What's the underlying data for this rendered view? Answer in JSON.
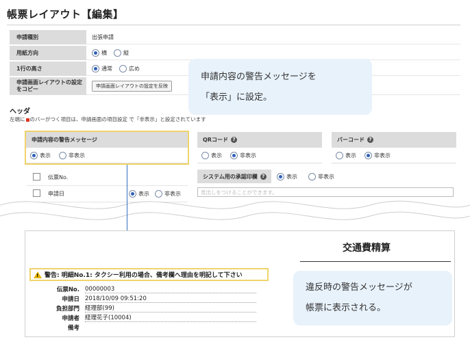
{
  "page_title": "帳票レイアウト【編集】",
  "form": {
    "rows": [
      {
        "label": "申請種別",
        "value": "出張申請"
      },
      {
        "label": "用紙方向",
        "options": [
          "横",
          "縦"
        ],
        "selected": 0
      },
      {
        "label": "1行の高さ",
        "options": [
          "通常",
          "広め"
        ],
        "selected": 0
      },
      {
        "label": "申請画面レイアウトの設定をコピー",
        "button": "申請画面レイアウトの設定を反映"
      }
    ]
  },
  "callout_top": {
    "line1": "申請内容の警告メッセージを",
    "line2": "「表示」に設定。"
  },
  "header_section": {
    "title": "ヘッダ",
    "note_before": "左端に",
    "note_after": "のバーがつく項目は、申請画面の項目設定 で「非表示」と設定されています"
  },
  "settings": {
    "warning_message": {
      "title": "申請内容の警告メッセージ",
      "options": [
        "表示",
        "非表示"
      ],
      "selected": 0
    },
    "qr_code": {
      "title": "QRコード",
      "options": [
        "表示",
        "非表示"
      ],
      "selected": 1
    },
    "barcode": {
      "title": "バーコード",
      "options": [
        "表示",
        "非表示"
      ],
      "selected": 1
    },
    "approval_stamp": {
      "title": "システム用の承認印欄",
      "options": [
        "表示",
        "非表示"
      ],
      "selected": 0
    },
    "stamp_placeholder": "見出しをつけることができます。"
  },
  "fields": [
    {
      "label": "伝票No."
    },
    {
      "label": "申請日",
      "options": [
        "表示",
        "非表示"
      ],
      "selected": 0
    }
  ],
  "document": {
    "title": "交通費精算",
    "warning": "警告: 明細No.1: タクシー利用の場合、備考欄へ理由を明記して下さい",
    "rows": [
      {
        "label": "伝票No.",
        "value": "00000003"
      },
      {
        "label": "申請日",
        "value": "2018/10/09 09:51:20"
      },
      {
        "label": "負担部門",
        "value": "経理部(99)"
      },
      {
        "label": "申請者",
        "value": "経理花子(10004)"
      },
      {
        "label": "備考",
        "value": ""
      }
    ]
  },
  "callout_bottom": {
    "line1": "違反時の警告メッセージが",
    "line2": "帳票に表示される。"
  },
  "colors": {
    "highlight": "#f0d36a",
    "bubble": "#e8f2fb",
    "radio_on": "#2f5fb8",
    "arrow": "#2f6fc0"
  }
}
